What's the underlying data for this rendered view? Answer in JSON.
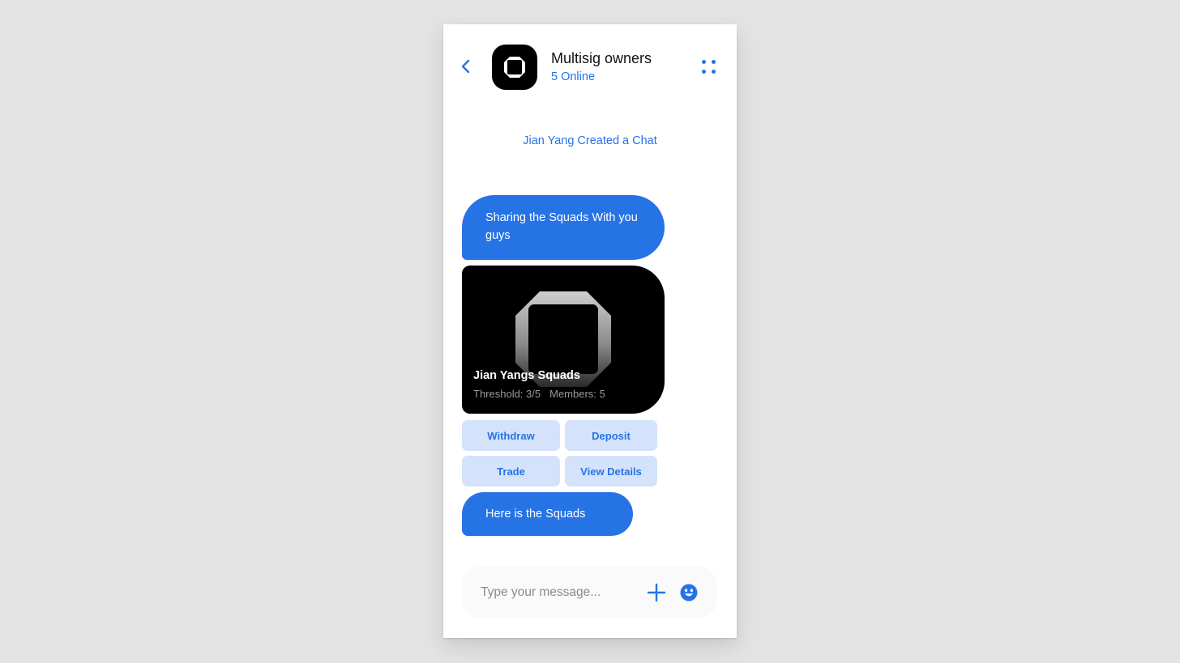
{
  "colors": {
    "accent": "#2673e6",
    "action_button_bg": "#d4e3fb",
    "card_bg": "#000000"
  },
  "header": {
    "back_icon": "chevron-left-icon",
    "avatar_icon": "squads-logo-icon",
    "title": "Multisig owners",
    "subtitle": "5 Online",
    "menu_icon": "four-dots-menu-icon"
  },
  "chat": {
    "system_message": "Jian Yang Created a Chat",
    "messages": [
      {
        "type": "text",
        "text": "Sharing the Squads With you guys"
      },
      {
        "type": "squad-card",
        "name": "Jian Yangs Squads",
        "threshold": "Threshold: 3/5",
        "members": "Members: 5",
        "actions": [
          {
            "label": "Withdraw"
          },
          {
            "label": "Deposit"
          },
          {
            "label": "Trade"
          },
          {
            "label": "View Details"
          }
        ]
      },
      {
        "type": "text",
        "text": "Here is the Squads"
      }
    ]
  },
  "composer": {
    "placeholder": "Type your message...",
    "value": "",
    "add_icon": "plus-icon",
    "emoji_icon": "smiley-icon"
  }
}
